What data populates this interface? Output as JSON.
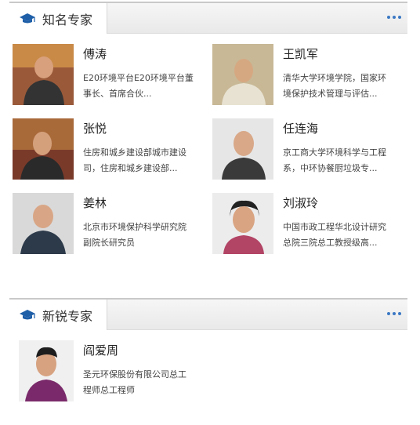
{
  "famous": {
    "title": "知名专家",
    "experts": [
      {
        "name": "傅涛",
        "desc_line1": "E20环境平台E20环境平台董",
        "desc_line2": "事长、首席合伙..."
      },
      {
        "name": "王凯军",
        "desc_line1": "清华大学环境学院，国家环",
        "desc_line2": "境保护技术管理与评估..."
      },
      {
        "name": "张悦",
        "desc_line1": "住房和城乡建设部城市建设",
        "desc_line2": "司，住房和城乡建设部..."
      },
      {
        "name": "任连海",
        "desc_line1": "京工商大学环境科学与工程",
        "desc_line2": "系，中环协餐厨垃圾专..."
      },
      {
        "name": "姜林",
        "desc_line1": "北京市环境保护科学研究院",
        "desc_line2": "副院长研究员"
      },
      {
        "name": "刘淑玲",
        "desc_line1": "中国市政工程华北设计研究",
        "desc_line2": "总院三院总工教授级高..."
      }
    ]
  },
  "emerging": {
    "title": "新锐专家",
    "experts": [
      {
        "name": "阎爱周",
        "desc_line1": "圣元环保股份有限公司总工",
        "desc_line2": "程师总工程师"
      }
    ]
  },
  "icons": {
    "section": "graduation-cap-icon",
    "more": "more-dots-icon"
  },
  "colors": {
    "accent": "#3a78c4"
  }
}
